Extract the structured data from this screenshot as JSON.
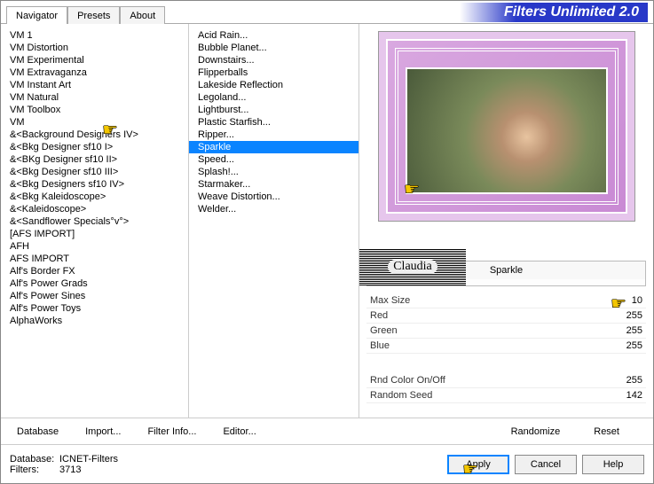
{
  "header": {
    "tabs": [
      "Navigator",
      "Presets",
      "About"
    ],
    "active_tab": 0,
    "brand": "Filters Unlimited 2.0"
  },
  "categories": [
    "VM 1",
    "VM Distortion",
    "VM Experimental",
    "VM Extravaganza",
    "VM Instant Art",
    "VM Natural",
    "VM Toolbox",
    "VM",
    "&<Background Designers IV>",
    "&<Bkg Designer sf10 I>",
    "&<BKg Designer sf10 II>",
    "&<Bkg Designer sf10 III>",
    "&<Bkg Designers sf10 IV>",
    "&<Bkg Kaleidoscope>",
    "&<Kaleidoscope>",
    "&<Sandflower Specials°v°>",
    "[AFS IMPORT]",
    "AFH",
    "AFS IMPORT",
    "Alf's Border FX",
    "Alf's Power Grads",
    "Alf's Power Sines",
    "Alf's Power Toys",
    "AlphaWorks"
  ],
  "selected_category": 5,
  "filters": [
    "Acid Rain...",
    "Bubble Planet...",
    "Downstairs...",
    "Flipperballs",
    "Lakeside Reflection",
    "Legoland...",
    "Lightburst...",
    "Plastic Starfish...",
    "Ripper...",
    "Sparkle",
    "Speed...",
    "Splash!...",
    "Starmaker...",
    "Weave Distortion...",
    "Welder..."
  ],
  "selected_filter": 9,
  "current_filter_label": "Sparkle",
  "watermark_text": "Claudia",
  "params": [
    {
      "label": "Max Size",
      "value": 10
    },
    {
      "label": "Red",
      "value": 255
    },
    {
      "label": "Green",
      "value": 255
    },
    {
      "label": "Blue",
      "value": 255
    }
  ],
  "params2": [
    {
      "label": "Rnd Color On/Off",
      "value": 255
    },
    {
      "label": "Random Seed",
      "value": 142
    }
  ],
  "bottom_buttons": {
    "database": "Database",
    "import": "Import...",
    "filter_info": "Filter Info...",
    "editor": "Editor...",
    "randomize": "Randomize",
    "reset": "Reset"
  },
  "footer": {
    "db_label": "Database:",
    "db_value": "ICNET-Filters",
    "filters_label": "Filters:",
    "filters_value": "3713",
    "apply": "Apply",
    "cancel": "Cancel",
    "help": "Help"
  }
}
